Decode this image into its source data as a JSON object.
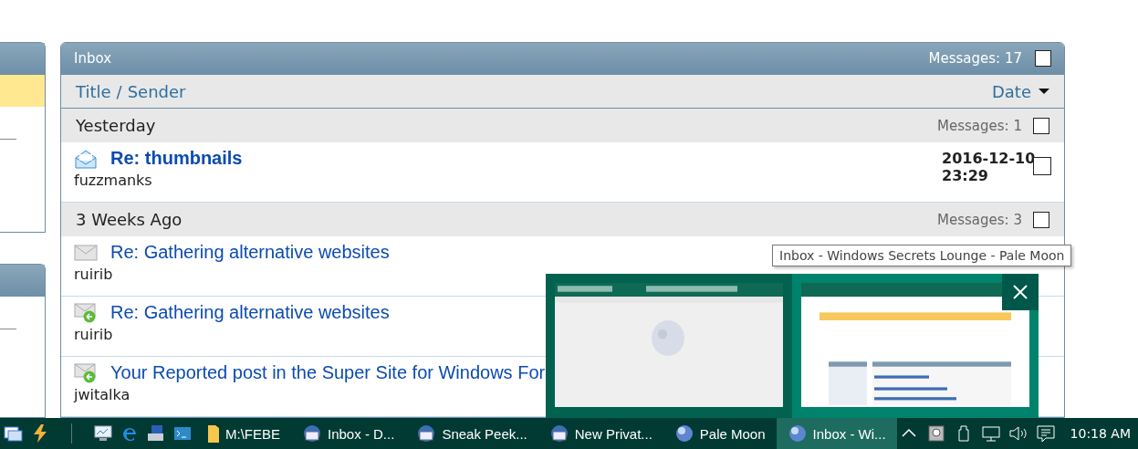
{
  "sidebar": {
    "panels": [
      {
        "rows": [
          {
            "selected": true
          },
          {
            "selected": false
          }
        ]
      },
      {
        "rows": [
          {
            "selected": false
          }
        ]
      }
    ]
  },
  "inbox": {
    "title": "Inbox",
    "count_label": "Messages: 17",
    "checked": false,
    "columns": {
      "title": "Title",
      "separator": "/",
      "sender": "Sender",
      "date": "Date"
    },
    "groups": [
      {
        "label": "Yesterday",
        "count_label": "Messages: 1",
        "checked": false,
        "messages": [
          {
            "kind": "new",
            "title": "Re: thumbnails",
            "sender": "fuzzmanks",
            "date": [
              "2016-12-10",
              "23:29"
            ],
            "checked": false
          }
        ]
      },
      {
        "label": "3 Weeks Ago",
        "count_label": "Messages: 3",
        "checked": false,
        "messages": [
          {
            "kind": "read",
            "title": "Re: Gathering alternative websites",
            "sender": "ruirib"
          },
          {
            "kind": "replied",
            "title": "Re: Gathering alternative websites",
            "sender": "ruirib"
          },
          {
            "kind": "replied",
            "title": "Your Reported post in the Super Site for Windows For",
            "sender": "jwitalka"
          }
        ]
      }
    ]
  },
  "tooltip": "Inbox - Windows Secrets Lounge - Pale Moon",
  "preview": {
    "thumbnails": [
      {
        "kind": "picture",
        "selected": false
      },
      {
        "kind": "picture",
        "selected": true
      }
    ]
  },
  "taskbar": {
    "items": [
      {
        "kind": "windows"
      },
      {
        "kind": "bolt"
      },
      {
        "kind": "separator"
      },
      {
        "kind": "monitor"
      },
      {
        "kind": "edge"
      },
      {
        "kind": "device"
      },
      {
        "kind": "terminal"
      },
      {
        "kind": "folder",
        "label": "M:\\FEBE",
        "selected": false
      },
      {
        "kind": "mail",
        "label": "Inbox - D...",
        "selected": false
      },
      {
        "kind": "mail",
        "label": "Sneak Peek...",
        "selected": false
      },
      {
        "kind": "mail",
        "label": "New Privat...",
        "selected": false
      },
      {
        "kind": "globe",
        "label": "Pale Moon",
        "selected": false
      },
      {
        "kind": "globe",
        "label": "Inbox - Wi...",
        "selected": true
      }
    ],
    "tray": [
      {
        "kind": "chevron"
      },
      {
        "kind": "disk"
      },
      {
        "kind": "usb"
      },
      {
        "kind": "network"
      },
      {
        "kind": "volume"
      },
      {
        "kind": "notifications"
      }
    ],
    "clock": "10:18 AM"
  }
}
